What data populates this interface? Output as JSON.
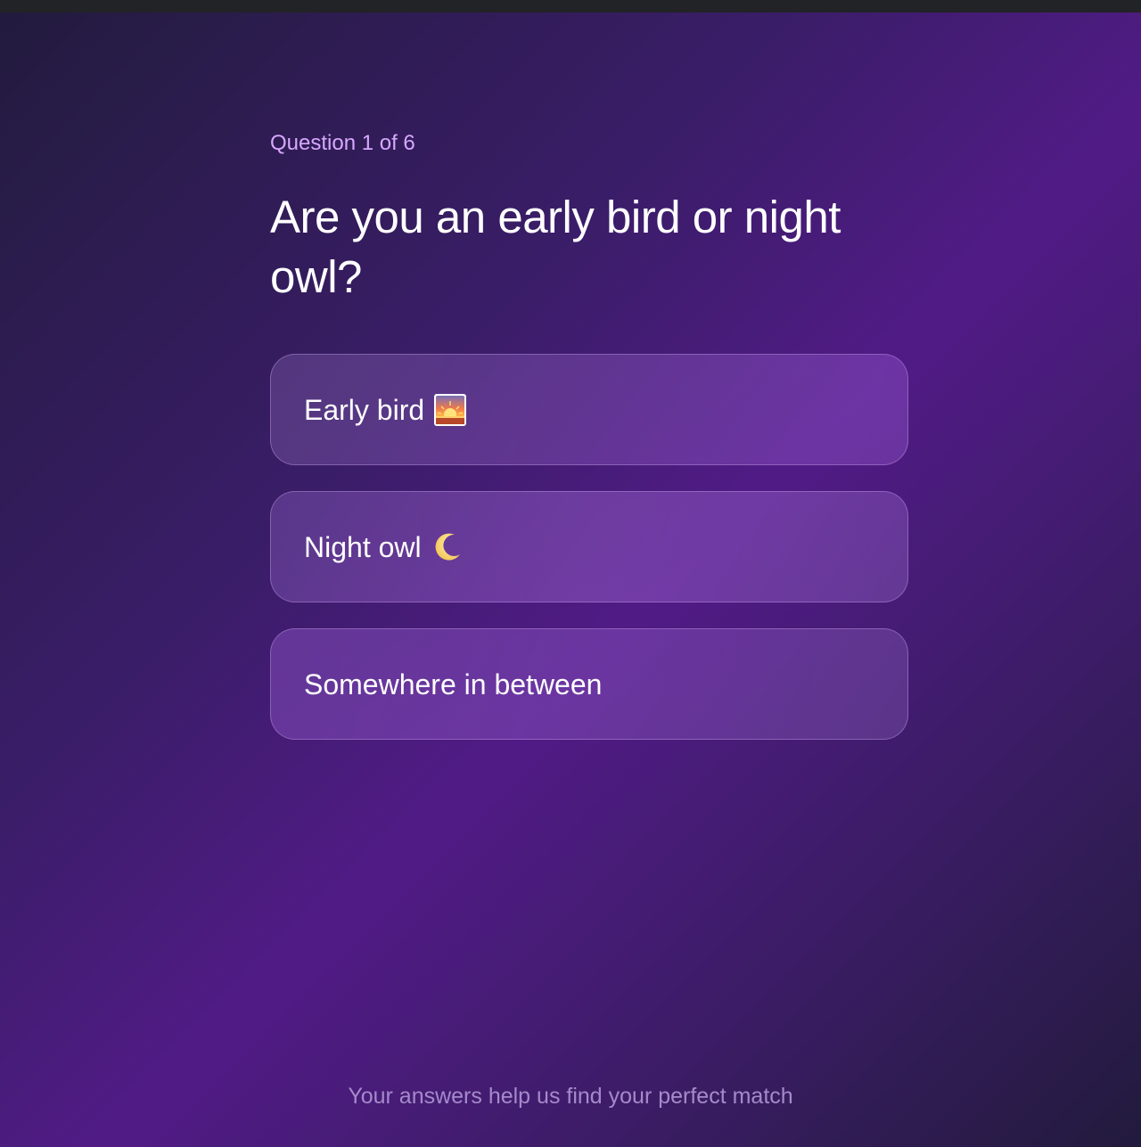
{
  "progress": {
    "label": "Question 1 of 6",
    "current": 1,
    "total": 6
  },
  "question": {
    "text": "Are you an early bird or night owl?"
  },
  "options": [
    {
      "label": "Early bird",
      "icon": "sunrise-emoji"
    },
    {
      "label": "Night owl",
      "icon": "crescent-moon-emoji"
    },
    {
      "label": "Somewhere in between"
    }
  ],
  "footer": {
    "note": "Your answers help us find your perfect match"
  },
  "colors": {
    "progress_label": "#d7a8ff",
    "question_text": "#ffffff",
    "footer_text": "#a58acb",
    "background_accent": "#511b86",
    "background_dark": "#221b3d"
  }
}
